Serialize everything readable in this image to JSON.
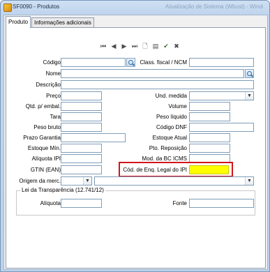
{
  "window": {
    "title": "SF0090 - Produtos",
    "background_title": "Atualização de Sistema (Wbust) - Windows Internet Explorer"
  },
  "tabs": [
    {
      "label": "Produto",
      "active": true
    },
    {
      "label": "Informações adicionais",
      "active": false
    }
  ],
  "toolbar": {
    "buttons": [
      "first-icon",
      "prev-icon",
      "next-icon",
      "last-icon",
      "new-icon",
      "edit-icon",
      "save-icon",
      "cancel-icon"
    ],
    "glyphs": [
      "⏮",
      "◀",
      "▶",
      "⏭",
      "🗋",
      "▤",
      "✔",
      "✖"
    ]
  },
  "fields": {
    "codigo": {
      "label": "Código",
      "value": ""
    },
    "classe_fiscal": {
      "label": "Class. fiscal / NCM",
      "value": ""
    },
    "nome": {
      "label": "Nome",
      "value": ""
    },
    "descricao": {
      "label": "Descrição",
      "value": ""
    },
    "preco": {
      "label": "Preço",
      "value": ""
    },
    "und_medida": {
      "label": "Und. medida",
      "value": ""
    },
    "qtd_embal": {
      "label": "Qtd. p/ embal.",
      "value": ""
    },
    "volume": {
      "label": "Volume",
      "value": ""
    },
    "tara": {
      "label": "Tara",
      "value": ""
    },
    "peso_liquido": {
      "label": "Peso líquido",
      "value": ""
    },
    "peso_bruto": {
      "label": "Peso bruto",
      "value": ""
    },
    "codigo_dnf": {
      "label": "Código DNF",
      "value": ""
    },
    "prazo_garantia": {
      "label": "Prazo Garantia",
      "value": ""
    },
    "estoque_atual": {
      "label": "Estoque Atual",
      "value": ""
    },
    "estoque_min": {
      "label": "Estoque Mín.",
      "value": ""
    },
    "pto_reposicao": {
      "label": "Pto. Reposição",
      "value": ""
    },
    "aliquota_ipi": {
      "label": "Alíquota IPI",
      "value": ""
    },
    "mod_bc_icms": {
      "label": "Mod. da BC ICMS",
      "value": ""
    },
    "gtin": {
      "label": "GTIN (EAN)",
      "value": ""
    },
    "cod_enq_ipi": {
      "label": "Cód. de Enq. Legal do IPI",
      "value": ""
    },
    "origem_merc": {
      "label": "Origem da merc.",
      "value": "",
      "detail": ""
    }
  },
  "lei_transparencia": {
    "title": "Lei da Transparência (12.741/12)",
    "aliquota": {
      "label": "Alíquota",
      "value": ""
    },
    "fonte": {
      "label": "Fonte",
      "value": ""
    }
  },
  "colors": {
    "highlight_field": "#ffff00",
    "highlight_border": "#d4141b"
  }
}
